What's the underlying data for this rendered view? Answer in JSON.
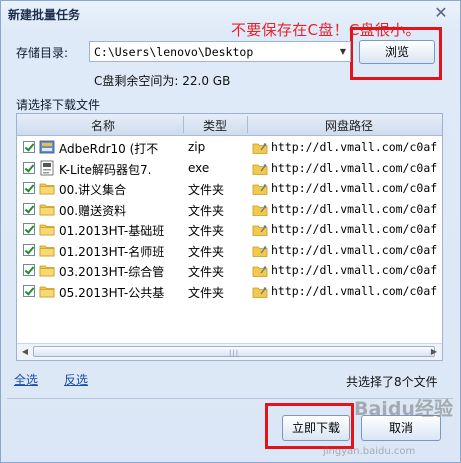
{
  "dialog": {
    "title": "新建批量任务",
    "close_glyph": "✕"
  },
  "annotation": "不要保存在C盘！C盘很小。",
  "storage": {
    "label": "存储目录:",
    "path": "C:\\Users\\lenovo\\Desktop",
    "browse_label": "浏览",
    "free_space": "C盘剩余空间为: 22.0 GB"
  },
  "list": {
    "caption": "请选择下载文件",
    "columns": [
      "名称",
      "类型",
      "网盘路径"
    ],
    "rows": [
      {
        "name": "AdbeRdr10 (打不",
        "type": "zip",
        "url": "http://dl.vmall.com/c0af",
        "icon": "installer-icon"
      },
      {
        "name": "K-Lite解码器包7.",
        "type": "exe",
        "url": "http://dl.vmall.com/c0af",
        "icon": "exe-icon"
      },
      {
        "name": "00.讲义集合",
        "type": "文件夹",
        "url": "http://dl.vmall.com/c0af",
        "icon": "folder-icon"
      },
      {
        "name": "00.赠送资料",
        "type": "文件夹",
        "url": "http://dl.vmall.com/c0af",
        "icon": "folder-icon"
      },
      {
        "name": "01.2013HT-基础班",
        "type": "文件夹",
        "url": "http://dl.vmall.com/c0af",
        "icon": "folder-icon"
      },
      {
        "name": "01.2013HT-名师班",
        "type": "文件夹",
        "url": "http://dl.vmall.com/c0af",
        "icon": "folder-icon"
      },
      {
        "name": "03.2013HT-综合管",
        "type": "文件夹",
        "url": "http://dl.vmall.com/c0af",
        "icon": "folder-icon"
      },
      {
        "name": "05.2013HT-公共基",
        "type": "文件夹",
        "url": "http://dl.vmall.com/c0af",
        "icon": "folder-icon"
      }
    ]
  },
  "footer": {
    "select_all": "全选",
    "invert": "反选",
    "selected_count": "共选择了8个文件",
    "download_now": "立即下载",
    "cancel": "取消"
  },
  "watermark": {
    "brand": "Baidu经验",
    "url": "jingyan.baidu.com"
  },
  "colors": {
    "annotation_red": "#e8222a",
    "link_blue": "#1a4fa8"
  }
}
